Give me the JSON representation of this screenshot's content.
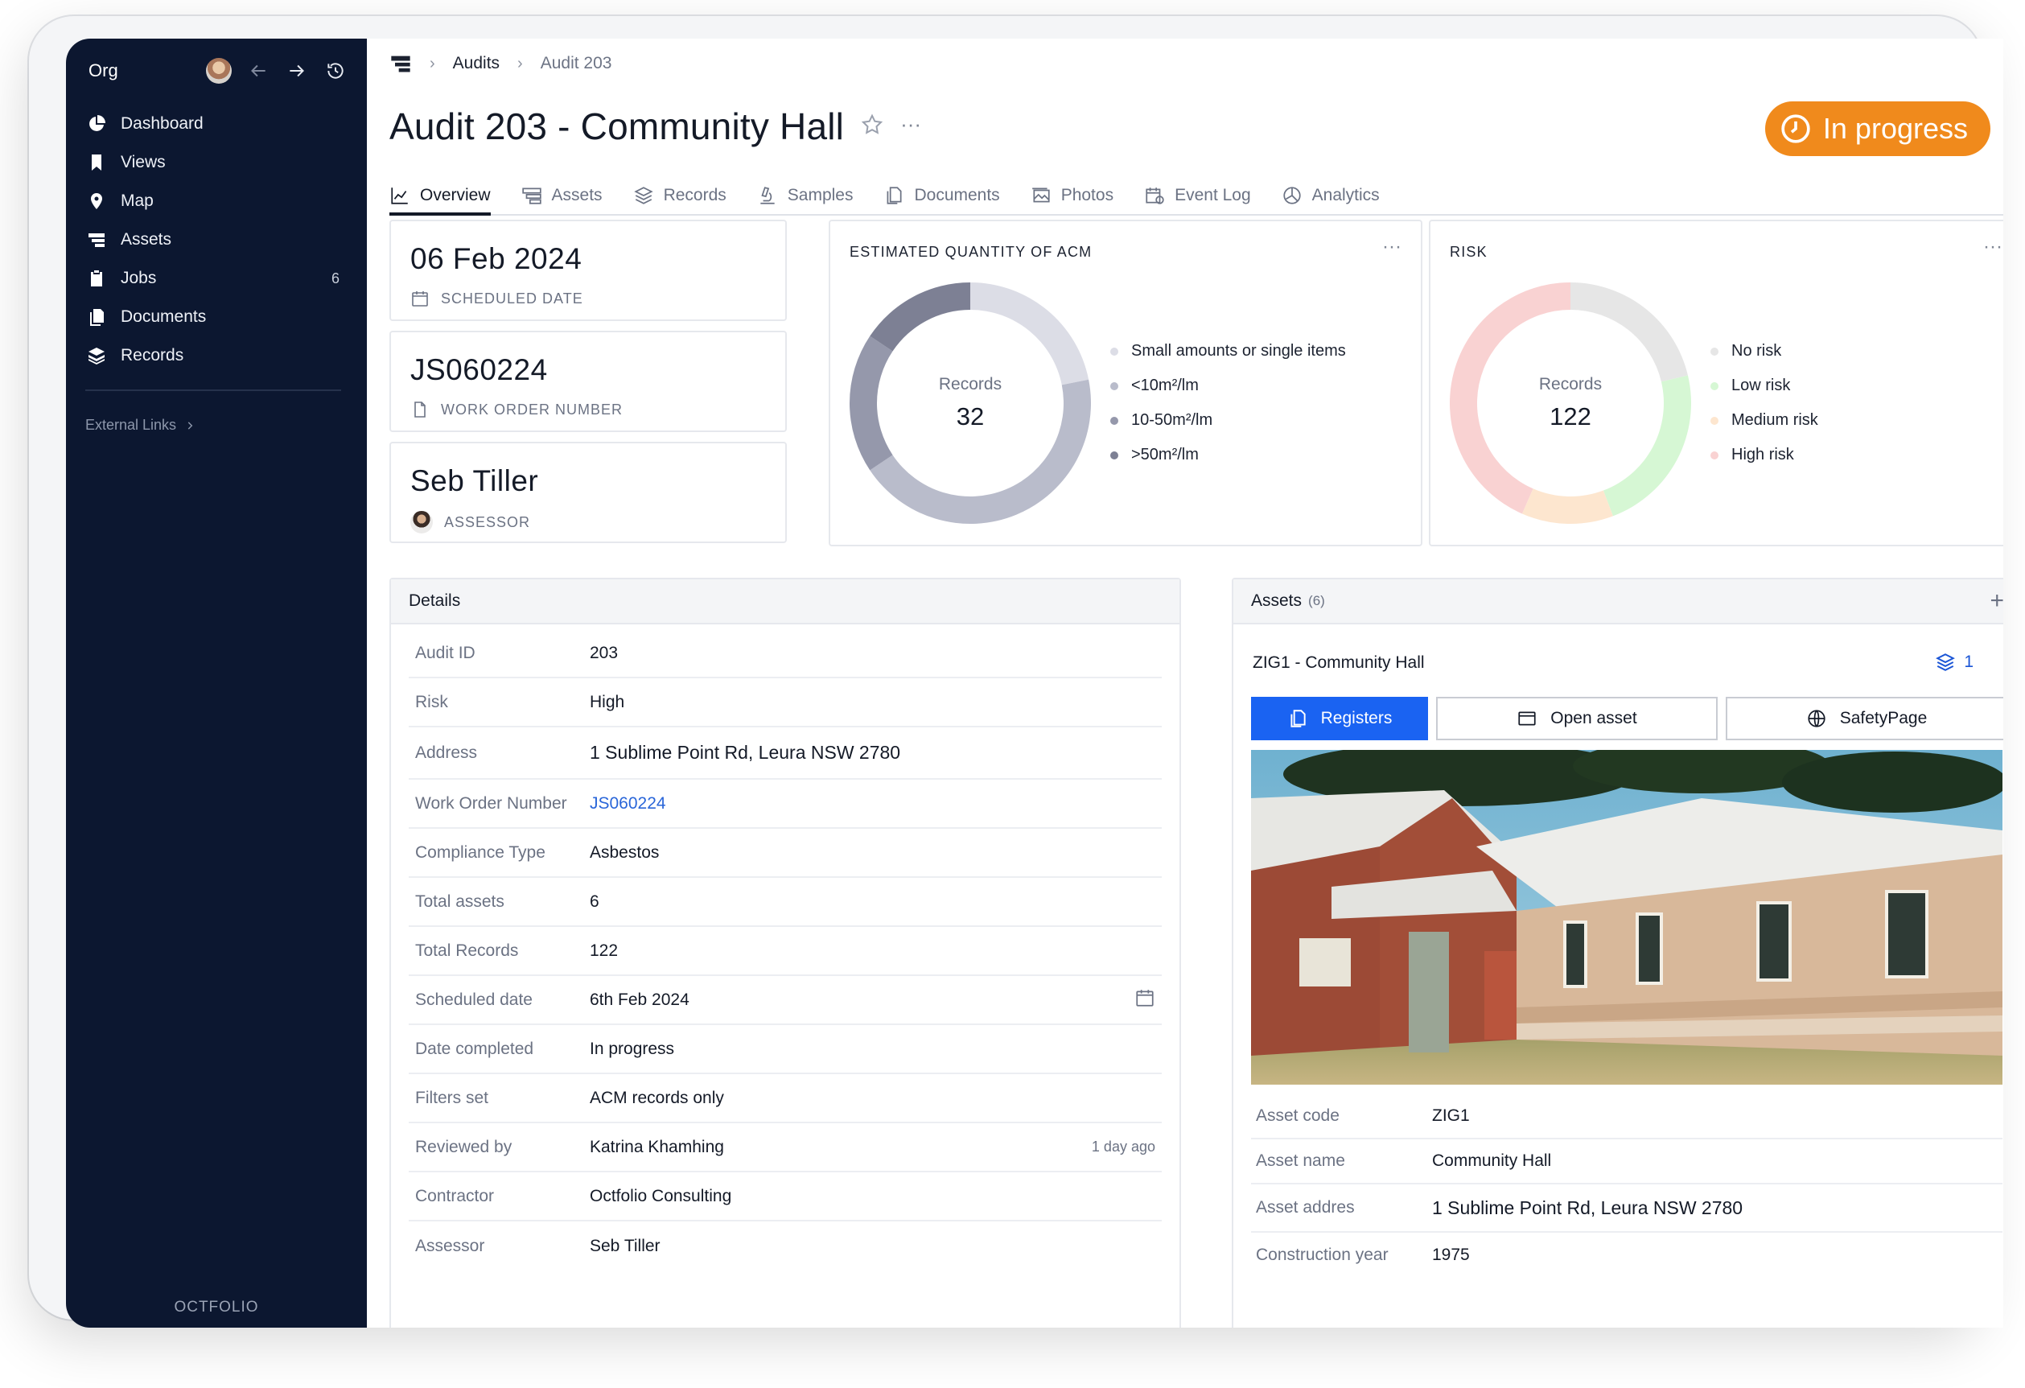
{
  "sidebar": {
    "org": "Org",
    "nav": [
      {
        "label": "Dashboard",
        "icon": "pie-chart-icon",
        "count": ""
      },
      {
        "label": "Views",
        "icon": "bookmark-icon",
        "count": ""
      },
      {
        "label": "Map",
        "icon": "map-pin-icon",
        "count": ""
      },
      {
        "label": "Assets",
        "icon": "building-icon",
        "count": ""
      },
      {
        "label": "Jobs",
        "icon": "clipboard-icon",
        "count": "6"
      },
      {
        "label": "Documents",
        "icon": "documents-icon",
        "count": ""
      },
      {
        "label": "Records",
        "icon": "layers-icon",
        "count": ""
      }
    ],
    "external_links": "External Links",
    "brand": "OCTFOLIO"
  },
  "breadcrumb": {
    "parent": "Audits",
    "current": "Audit 203"
  },
  "page": {
    "title": "Audit 203 - Community Hall",
    "status": "In progress",
    "status_color": "#f08a1c"
  },
  "tabs": [
    "Overview",
    "Assets",
    "Records",
    "Samples",
    "Documents",
    "Photos",
    "Event Log",
    "Analytics"
  ],
  "summary": {
    "scheduled_date": {
      "value": "06 Feb 2024",
      "label": "SCHEDULED DATE"
    },
    "work_order": {
      "value": "JS060224",
      "label": "WORK ORDER NUMBER"
    },
    "assessor": {
      "value": "Seb Tiller",
      "label": "ASSESSOR"
    }
  },
  "charts": {
    "acm": {
      "title": "ESTIMATED QUANTITY OF ACM",
      "center_label": "Records",
      "center_value": "32"
    },
    "risk": {
      "title": "RISK",
      "center_label": "Records",
      "center_value": "122"
    }
  },
  "chart_data": [
    {
      "type": "pie",
      "title": "ESTIMATED QUANTITY OF ACM",
      "categories": [
        "Small amounts or single items",
        "<10m²/lm",
        "10-50m²/lm",
        ">50m²/lm"
      ],
      "values": [
        7,
        14,
        6,
        5
      ],
      "colors": [
        "#dcdde6",
        "#b9bccb",
        "#9598ab",
        "#7d8094"
      ]
    },
    {
      "type": "pie",
      "title": "RISK",
      "categories": [
        "No risk",
        "Low risk",
        "Medium risk",
        "High risk"
      ],
      "values": [
        26,
        28,
        15,
        53
      ],
      "colors": [
        "#e6e6e6",
        "#d6f7d4",
        "#fde6cf",
        "#f9d2d2"
      ]
    }
  ],
  "details": {
    "title": "Details",
    "rows": [
      {
        "k": "Audit ID",
        "v": "203",
        "aside": ""
      },
      {
        "k": "Risk",
        "v": "High",
        "aside": ""
      },
      {
        "k": "Address",
        "v": "1 Sublime Point Rd, Leura NSW 2780",
        "aside": ""
      },
      {
        "k": "Work Order Number",
        "v": "JS060224",
        "aside": ""
      },
      {
        "k": "Compliance Type",
        "v": "Asbestos",
        "aside": ""
      },
      {
        "k": "Total assets",
        "v": "6",
        "aside": ""
      },
      {
        "k": "Total Records",
        "v": "122",
        "aside": ""
      },
      {
        "k": "Scheduled date",
        "v": "6th Feb 2024",
        "aside": ""
      },
      {
        "k": "Date completed",
        "v": "In progress",
        "aside": ""
      },
      {
        "k": "Filters set",
        "v": "ACM records only",
        "aside": ""
      },
      {
        "k": "Reviewed by",
        "v": "Katrina Khamhing",
        "aside": "1 day ago"
      },
      {
        "k": "Contractor",
        "v": "Octfolio Consulting",
        "aside": ""
      },
      {
        "k": "Assessor",
        "v": "Seb Tiller",
        "aside": ""
      }
    ]
  },
  "assets": {
    "title": "Assets",
    "count": "(6)",
    "asset_name": "ZIG1 - Community Hall",
    "layers_count": "1",
    "buttons": {
      "registers": "Registers",
      "open_asset": "Open asset",
      "safety_page": "SafetyPage"
    },
    "rows": [
      {
        "k": "Asset code",
        "v": "ZIG1"
      },
      {
        "k": "Asset name",
        "v": "Community Hall"
      },
      {
        "k": "Asset addres",
        "v": "1 Sublime Point Rd, Leura NSW 2780"
      },
      {
        "k": "Construction year",
        "v": "1975"
      }
    ]
  }
}
